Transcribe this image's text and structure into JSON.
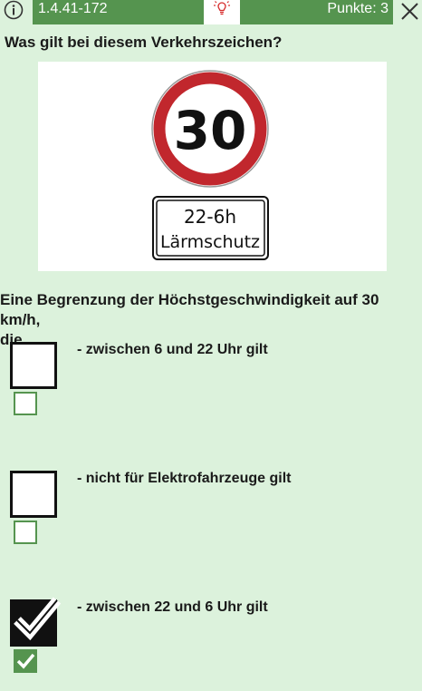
{
  "header": {
    "question_id": "1.4.41-172",
    "points_label": "Punkte: 3",
    "info_icon": "info-icon",
    "hint_icon": "lightbulb-icon",
    "close_icon": "close-icon"
  },
  "question": {
    "title": "Was gilt bei diesem Verkehrszeichen?",
    "stem_line1": "Eine Begrenzung der Höchstgeschwindigkeit auf 30 km/h,",
    "stem_line2": "die"
  },
  "sign": {
    "speed_limit": "30",
    "time_range": "22-6h",
    "note": "Lärmschutz"
  },
  "answers": [
    {
      "text": "- zwischen 6 und 22 Uhr gilt",
      "selected": false,
      "correct": false
    },
    {
      "text": "- nicht für Elektrofahrzeuge gilt",
      "selected": false,
      "correct": false
    },
    {
      "text": "- zwischen 22 und 6 Uhr gilt",
      "selected": true,
      "correct": true
    }
  ],
  "colors": {
    "background": "#dcf2dc",
    "header_green": "#55944f",
    "sign_red": "#c1272d"
  }
}
